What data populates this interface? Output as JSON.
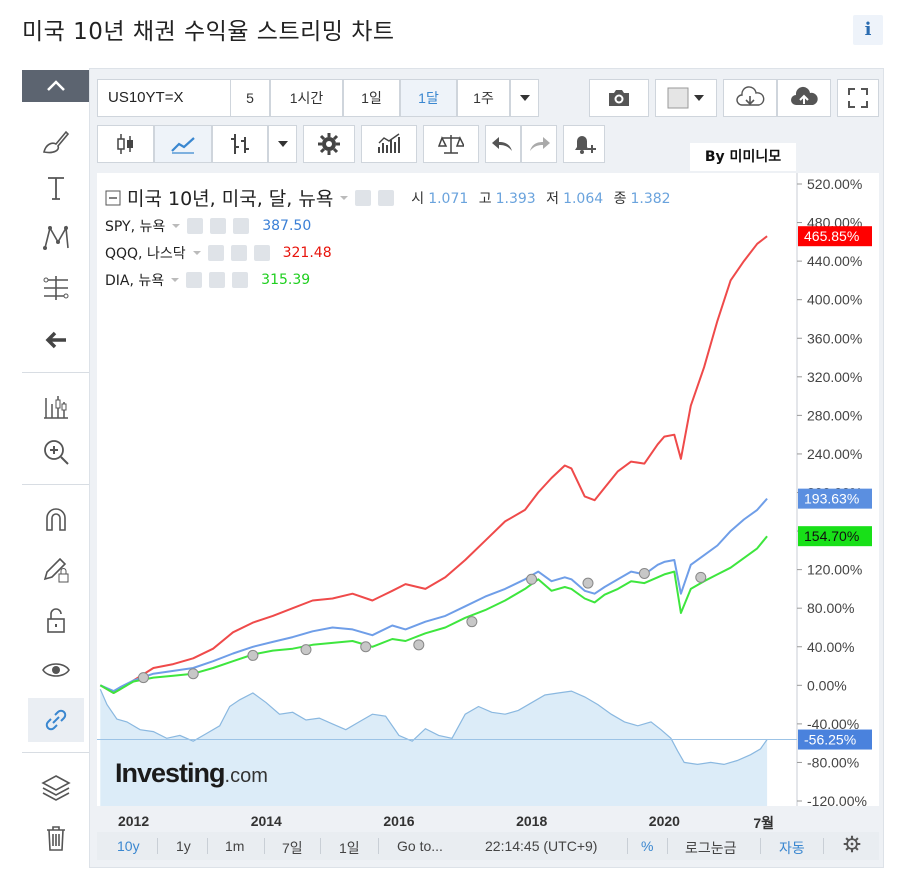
{
  "page": {
    "title": "미국 10년 채권 수익율 스트리밍 차트",
    "info_label": "i"
  },
  "toolbar": {
    "symbol": "US10YT=X",
    "intervals": [
      "5",
      "1시간",
      "1일",
      "1달",
      "1주"
    ],
    "selected_interval": "1달"
  },
  "watermark": "By 미미니모",
  "legend": {
    "main": "미국 10년, 미국, 달, 뉴욕",
    "ohlc": [
      {
        "label": "시",
        "value": "1.071"
      },
      {
        "label": "고",
        "value": "1.393"
      },
      {
        "label": "저",
        "value": "1.064"
      },
      {
        "label": "종",
        "value": "1.382"
      }
    ],
    "series": [
      {
        "name": "SPY, 뉴욕",
        "value": "387.50",
        "color": "#3a7fd6"
      },
      {
        "name": "QQQ, 나스닥",
        "value": "321.48",
        "color": "#e8140c"
      },
      {
        "name": "DIA, 뉴욕",
        "value": "315.39",
        "color": "#1fcf1f"
      }
    ]
  },
  "logo": {
    "main": "Investing",
    "suffix": ".com"
  },
  "bottom_bar": {
    "ranges": [
      "10y",
      "1y",
      "1m",
      "7일",
      "1일"
    ],
    "selected_range": "10y",
    "goto": "Go to...",
    "time": "22:14:45 (UTC+9)",
    "percent": "%",
    "log": "로그눈금",
    "auto": "자동"
  },
  "chart_data": {
    "type": "line",
    "title": "",
    "xlabel": "",
    "ylabel": "",
    "y_unit": "%",
    "ylim": [
      -120,
      520
    ],
    "y_ticks": [
      "520.00%",
      "480.00%",
      "440.00%",
      "400.00%",
      "360.00%",
      "320.00%",
      "280.00%",
      "240.00%",
      "200.00%",
      "160.00%",
      "120.00%",
      "80.00%",
      "40.00%",
      "0.00%",
      "-40.00%",
      "-80.00%",
      "-120.00%"
    ],
    "x_ticks": [
      "2012",
      "2014",
      "2016",
      "2018",
      "2020",
      "7월"
    ],
    "x_tick_years": [
      2012,
      2014,
      2016,
      2018,
      2020,
      2021.5
    ],
    "xlim": [
      2011.45,
      2022.0
    ],
    "grid": false,
    "series": [
      {
        "name": "QQQ, 나스닥",
        "color": "#ef4a4a",
        "last_label": "465.85%",
        "x": [
          2011.5,
          2011.7,
          2011.8,
          2012.0,
          2012.3,
          2012.6,
          2012.9,
          2013.2,
          2013.5,
          2013.8,
          2014.1,
          2014.4,
          2014.7,
          2015.0,
          2015.3,
          2015.6,
          2015.9,
          2016.1,
          2016.4,
          2016.7,
          2017.0,
          2017.3,
          2017.6,
          2017.9,
          2018.1,
          2018.3,
          2018.5,
          2018.6,
          2018.8,
          2018.95,
          2019.1,
          2019.3,
          2019.5,
          2019.7,
          2019.9,
          2020.0,
          2020.15,
          2020.25,
          2020.4,
          2020.6,
          2020.8,
          2021.0,
          2021.2,
          2021.4,
          2021.55
        ],
        "y": [
          0,
          -8,
          -4,
          5,
          18,
          22,
          28,
          38,
          55,
          65,
          72,
          80,
          88,
          90,
          95,
          88,
          98,
          105,
          100,
          112,
          130,
          150,
          170,
          182,
          200,
          215,
          228,
          225,
          196,
          192,
          205,
          222,
          232,
          230,
          250,
          258,
          260,
          235,
          290,
          330,
          378,
          420,
          440,
          458,
          465.85
        ]
      },
      {
        "name": "SPY, 뉴욕",
        "color": "#6f9ee8",
        "last_label": "193.63%",
        "x": [
          2011.5,
          2011.7,
          2011.8,
          2012.0,
          2012.3,
          2012.6,
          2012.9,
          2013.2,
          2013.5,
          2013.8,
          2014.1,
          2014.4,
          2014.7,
          2015.0,
          2015.3,
          2015.6,
          2015.9,
          2016.1,
          2016.4,
          2016.7,
          2017.0,
          2017.3,
          2017.6,
          2017.9,
          2018.1,
          2018.3,
          2018.5,
          2018.6,
          2018.8,
          2018.95,
          2019.1,
          2019.3,
          2019.5,
          2019.7,
          2019.9,
          2020.0,
          2020.15,
          2020.25,
          2020.4,
          2020.6,
          2020.8,
          2021.0,
          2021.2,
          2021.4,
          2021.55
        ],
        "y": [
          0,
          -6,
          -2,
          5,
          12,
          15,
          18,
          25,
          33,
          40,
          45,
          50,
          56,
          60,
          58,
          52,
          62,
          58,
          66,
          72,
          82,
          92,
          100,
          110,
          118,
          108,
          112,
          110,
          98,
          95,
          102,
          110,
          118,
          115,
          125,
          128,
          130,
          95,
          125,
          135,
          145,
          160,
          172,
          182,
          193.63
        ]
      },
      {
        "name": "DIA, 뉴욕",
        "color": "#3ee63e",
        "last_label": "154.70%",
        "x": [
          2011.5,
          2011.7,
          2011.8,
          2012.0,
          2012.3,
          2012.6,
          2012.9,
          2013.2,
          2013.5,
          2013.8,
          2014.1,
          2014.4,
          2014.7,
          2015.0,
          2015.3,
          2015.6,
          2015.9,
          2016.1,
          2016.4,
          2016.7,
          2017.0,
          2017.3,
          2017.6,
          2017.9,
          2018.1,
          2018.3,
          2018.5,
          2018.6,
          2018.8,
          2018.95,
          2019.1,
          2019.3,
          2019.5,
          2019.7,
          2019.9,
          2020.0,
          2020.15,
          2020.25,
          2020.4,
          2020.6,
          2020.8,
          2021.0,
          2021.2,
          2021.4,
          2021.55
        ],
        "y": [
          0,
          -8,
          -4,
          4,
          8,
          10,
          12,
          18,
          25,
          32,
          36,
          38,
          42,
          44,
          46,
          40,
          48,
          46,
          54,
          60,
          70,
          78,
          88,
          100,
          110,
          98,
          102,
          100,
          90,
          86,
          94,
          100,
          108,
          106,
          112,
          115,
          118,
          75,
          100,
          108,
          115,
          122,
          132,
          142,
          154.7
        ]
      },
      {
        "name": "미국 10년, 미국, 달, 뉴욕",
        "color": "#8ab8e0",
        "fill": "#dcecf8",
        "last_label": "-56.25%",
        "x": [
          2011.5,
          2011.6,
          2011.75,
          2011.9,
          2012.1,
          2012.3,
          2012.5,
          2012.7,
          2012.9,
          2013.1,
          2013.3,
          2013.45,
          2013.6,
          2013.8,
          2014.0,
          2014.2,
          2014.4,
          2014.6,
          2014.8,
          2015.0,
          2015.2,
          2015.4,
          2015.6,
          2015.8,
          2016.0,
          2016.2,
          2016.4,
          2016.6,
          2016.8,
          2017.0,
          2017.2,
          2017.4,
          2017.6,
          2017.8,
          2018.0,
          2018.2,
          2018.4,
          2018.6,
          2018.8,
          2019.0,
          2019.2,
          2019.4,
          2019.6,
          2019.8,
          2019.95,
          2020.1,
          2020.2,
          2020.3,
          2020.5,
          2020.7,
          2020.9,
          2021.1,
          2021.3,
          2021.45,
          2021.55
        ],
        "y": [
          -4,
          -20,
          -35,
          -38,
          -46,
          -48,
          -55,
          -52,
          -58,
          -50,
          -42,
          -22,
          -15,
          -8,
          -18,
          -30,
          -28,
          -36,
          -34,
          -40,
          -46,
          -38,
          -30,
          -32,
          -52,
          -58,
          -45,
          -52,
          -55,
          -30,
          -22,
          -28,
          -30,
          -26,
          -18,
          -10,
          -8,
          -6,
          -12,
          -20,
          -30,
          -38,
          -42,
          -38,
          -46,
          -55,
          -68,
          -80,
          -82,
          -80,
          -82,
          -78,
          -72,
          -66,
          -56.25
        ]
      }
    ],
    "markers_y": [
      8,
      12,
      31,
      37,
      40,
      42,
      66,
      110,
      106,
      116,
      112
    ],
    "markers_x": [
      2012.15,
      2012.9,
      2013.8,
      2014.6,
      2015.5,
      2016.3,
      2017.1,
      2018.0,
      2018.85,
      2019.7,
      2020.55
    ]
  }
}
